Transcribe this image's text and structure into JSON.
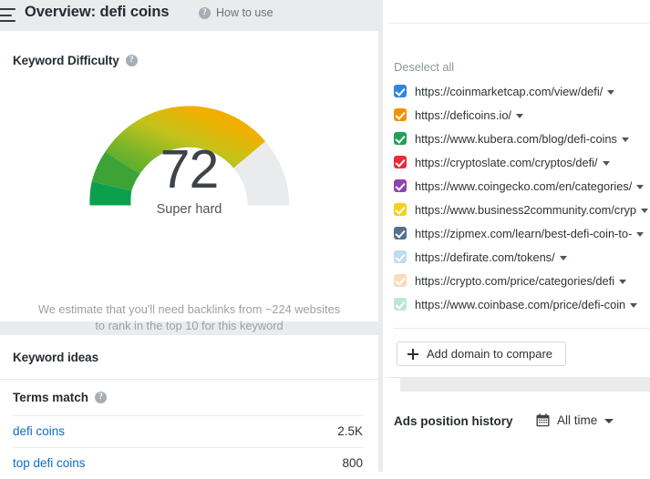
{
  "header": {
    "menu_icon": "hamburger-icon",
    "title": "Overview: defi coins",
    "help_icon": "question-mark-icon",
    "how_to_use": "How to use"
  },
  "keyword_difficulty": {
    "title": "Keyword Difficulty",
    "help_icon": "question-mark-icon",
    "score": "72",
    "label": "Super hard",
    "note_line1": "We estimate that you'll need backlinks from ~224 websites",
    "note_line2": "to rank in the top 10 for this keyword"
  },
  "keyword_ideas": {
    "title": "Keyword ideas",
    "section_label": "Terms match",
    "help_icon": "question-mark-icon",
    "rows": [
      {
        "term": "defi coins",
        "volume": "2.5K"
      },
      {
        "term": "top defi coins",
        "volume": "800"
      }
    ]
  },
  "compare_panel": {
    "deselect_all": "Deselect all",
    "add_domain_label": "Add domain to compare",
    "plus_icon": "plus-icon",
    "urls": [
      {
        "url": "https://coinmarketcap.com/view/defi/",
        "color": "#2e86de",
        "checked": true
      },
      {
        "url": "https://deficoins.io/",
        "color": "#f59000",
        "checked": true
      },
      {
        "url": "https://www.kubera.com/blog/defi-coins",
        "color": "#21a05a",
        "checked": true
      },
      {
        "url": "https://cryptoslate.com/cryptos/defi/",
        "color": "#ec2b38",
        "checked": true
      },
      {
        "url": "https://www.coingecko.com/en/categories/",
        "color": "#8e44ad",
        "checked": true
      },
      {
        "url": "https://www.business2community.com/cryp",
        "color": "#f7d117",
        "checked": true
      },
      {
        "url": "https://zipmex.com/learn/best-defi-coin-to-",
        "color": "#55708d",
        "checked": true
      },
      {
        "url": "https://defirate.com/tokens/",
        "color": "#bcdcf3",
        "checked": true
      },
      {
        "url": "https://crypto.com/price/categories/defi",
        "color": "#fadcbc",
        "checked": true
      },
      {
        "url": "https://www.coinbase.com/price/defi-coin",
        "color": "#bce8cf",
        "checked": true
      }
    ]
  },
  "ads_position_history": {
    "title": "Ads position history",
    "calendar_icon": "calendar-icon",
    "range_label": "All time"
  },
  "chart_data": {
    "type": "gauge",
    "title": "Keyword Difficulty",
    "value": 72,
    "min": 0,
    "max": 100,
    "value_label": "Super hard",
    "gradient_stops": [
      "#16a34a",
      "#7dbb2c",
      "#c8c420",
      "#f5a800",
      "#f9a600"
    ],
    "track_color": "#e8eaeb",
    "segments": [
      {
        "from": 0,
        "to": 10,
        "color": "#0fa14e"
      },
      {
        "from": 10,
        "to": 20,
        "color": "#4faa34"
      },
      {
        "from": 20,
        "to": 72,
        "color": "gradient"
      },
      {
        "from": 72,
        "to": 100,
        "color": "#e8eaeb"
      }
    ]
  }
}
